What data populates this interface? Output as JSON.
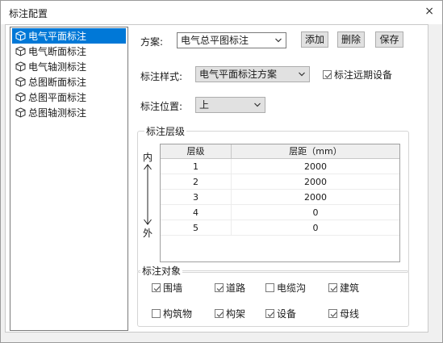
{
  "window": {
    "title": "标注配置",
    "close_glyph": "×"
  },
  "tree": {
    "items": [
      {
        "label": "电气平面标注",
        "selected": true
      },
      {
        "label": "电气断面标注",
        "selected": false
      },
      {
        "label": "电气轴测标注",
        "selected": false
      },
      {
        "label": "总图断面标注",
        "selected": false
      },
      {
        "label": "总图平面标注",
        "selected": false
      },
      {
        "label": "总图轴测标注",
        "selected": false
      }
    ],
    "icon": "cube-icon"
  },
  "scheme": {
    "label": "方案:",
    "value": "电气总平图标注",
    "add_label": "添加",
    "delete_label": "删除",
    "save_label": "保存"
  },
  "style": {
    "label": "标注样式:",
    "value": "电气平面标注方案",
    "far_devices": {
      "label": "标注远期设备",
      "checked": true
    }
  },
  "position": {
    "label": "标注位置:",
    "value": "上"
  },
  "levels": {
    "title": "标注层级",
    "inner": "内",
    "outer": "外",
    "headers": [
      "层级",
      "层距（mm）"
    ],
    "rows": [
      [
        "1",
        "2000"
      ],
      [
        "2",
        "2000"
      ],
      [
        "3",
        "2000"
      ],
      [
        "4",
        "0"
      ],
      [
        "5",
        "0"
      ]
    ]
  },
  "objects": {
    "title": "标注对象",
    "items": [
      {
        "label": "围墙",
        "checked": true
      },
      {
        "label": "道路",
        "checked": true
      },
      {
        "label": "电缆沟",
        "checked": false
      },
      {
        "label": "建筑",
        "checked": true
      },
      {
        "label": "构筑物",
        "checked": false
      },
      {
        "label": "构架",
        "checked": true
      },
      {
        "label": "设备",
        "checked": true
      },
      {
        "label": "母线",
        "checked": true
      }
    ]
  },
  "colors": {
    "selection": "#0078d7",
    "window_bg": "#f0f0f0",
    "panel_bg": "#ffffff"
  }
}
